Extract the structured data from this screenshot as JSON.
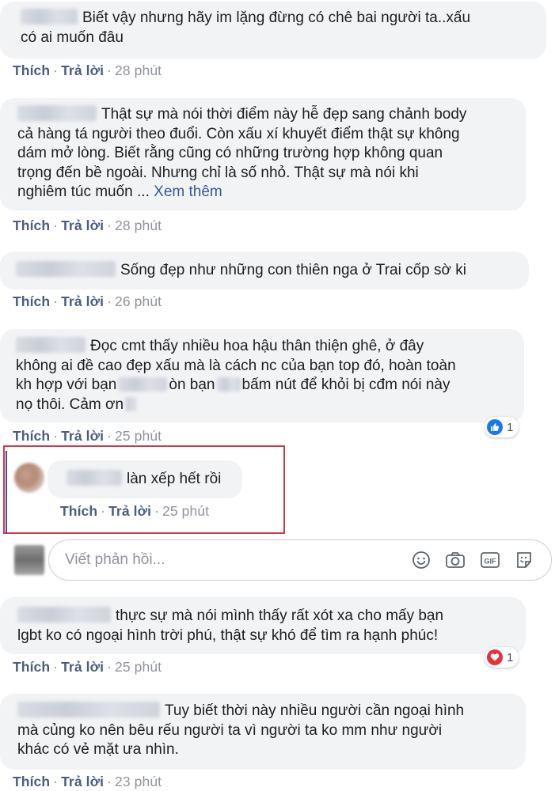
{
  "comments": [
    {
      "text_lines": [
        "Biết vậy nhưng hãy im lặng đừng có chê bai người ta..xấu",
        "có ai muốn đâu"
      ],
      "like": "Thích",
      "reply": "Trả lời",
      "time": "28 phút"
    },
    {
      "text_lines": [
        "Thật sự mà nói thời điểm này hễ đẹp sang chảnh body",
        "cả hàng tá người theo đuổi. Còn xấu xí khuyết điểm thật sự không",
        "dám mở lòng. Biết rằng cũng có những trường hợp không quan",
        "trọng đến bề ngoài. Nhưng chỉ là số nhỏ. Thật sự mà nói khi",
        "nghiêm túc muốn ..."
      ],
      "see_more": "Xem thêm",
      "like": "Thích",
      "reply": "Trả lời",
      "time": "28 phút"
    },
    {
      "text_lines": [
        "Sống đẹp như những con thiên nga ở Trai cốp sờ ki"
      ],
      "like": "Thích",
      "reply": "Trả lời",
      "time": "26 phút"
    },
    {
      "text_lines": [
        "Đọc cmt thấy nhiều hoa hậu thân thiện ghê, ở đây",
        "không ai đề cao đẹp xấu mà là cách nc của bạn top đó, hoàn toàn",
        "kh hợp với bạn",
        "òn bạn",
        "bấm nút để khỏi bị cđm nói này",
        "nọ thôi. Cảm ơn"
      ],
      "like": "Thích",
      "reply": "Trả lời",
      "time": "25 phút",
      "reaction": {
        "icon": "like-icon",
        "count": "1",
        "color": "#1877f2"
      }
    },
    {
      "text_lines": [
        "làn xếp hết rồi"
      ],
      "like": "Thích",
      "reply": "Trả lời",
      "time": "25 phút",
      "highlight_color": "#cf3a47"
    },
    {
      "text_lines": [
        "thực sự mà nói mình thấy rất xót xa cho mấy bạn",
        "lgbt ko có ngoại hình trời phú, thật sự khó để tìm ra hạnh phúc!"
      ],
      "like": "Thích",
      "reply": "Trả lời",
      "time": "25 phút",
      "reaction": {
        "icon": "heart-icon",
        "count": "1",
        "color": "#e5323e"
      }
    },
    {
      "text_lines": [
        "Tuy biết thời này nhiều người cần ngoại hình",
        "mà củng ko nên bêu rếu người ta vì người ta ko mm như người",
        "khác có vẻ mặt ưa nhìn."
      ],
      "like": "Thích",
      "reply": "Trả lời",
      "time": "23 phút"
    }
  ],
  "reply_box": {
    "placeholder": "Viết phản hồi...",
    "icons": [
      "emoji-icon",
      "camera-icon",
      "gif-icon",
      "sticker-icon"
    ]
  }
}
